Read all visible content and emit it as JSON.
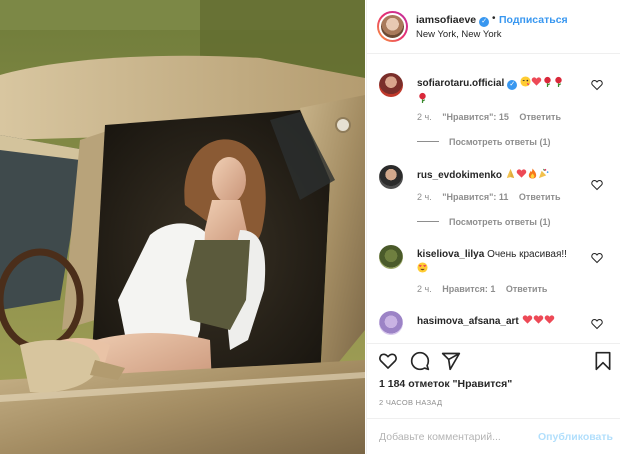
{
  "header": {
    "username": "iamsofiaeve",
    "verified_glyph": "✓",
    "separator": "•",
    "follow_label": "Подписаться",
    "location": "New York, New York"
  },
  "comments": [
    {
      "username": "sofiarotaru.official",
      "verified": true,
      "text": "",
      "emojis": [
        "winking-kiss-face",
        "red-heart",
        "rose",
        "rose",
        "rose"
      ],
      "time": "2 ч.",
      "likes": "\"Нравится\": 15",
      "reply": "Ответить",
      "view_replies": "Посмотреть ответы (1)"
    },
    {
      "username": "rus_evdokimenko",
      "verified": false,
      "text": "",
      "emojis": [
        "folded-hands",
        "red-heart",
        "fire",
        "party-popper"
      ],
      "time": "2 ч.",
      "likes": "\"Нравится\": 11",
      "reply": "Ответить",
      "view_replies": "Посмотреть ответы (1)"
    },
    {
      "username": "kiseliova_lilya",
      "verified": false,
      "text": "Очень красивая!!",
      "emojis": [
        "heart-eyes-face"
      ],
      "time": "2 ч.",
      "likes": "Нравится: 1",
      "reply": "Ответить"
    },
    {
      "username": "hasimova_afsana_art",
      "verified": false,
      "text": "",
      "emojis": [
        "red-heart",
        "red-heart",
        "red-heart"
      ]
    }
  ],
  "actions": {
    "icons": [
      "heart-icon",
      "comment-icon",
      "share-icon",
      "bookmark-icon"
    ]
  },
  "likes_text": "1 184 отметок \"Нравится\"",
  "time_ago": "2 ЧАСОВ НАЗАД",
  "add_comment": {
    "placeholder": "Добавьте комментарий...",
    "publish_label": "Опубликовать"
  },
  "colors": {
    "link_blue": "#3897f0",
    "publish_disabled": "#b2dffc",
    "muted_text": "#8e8e8e",
    "heart_red": "#ed4956",
    "border": "#efefef"
  }
}
